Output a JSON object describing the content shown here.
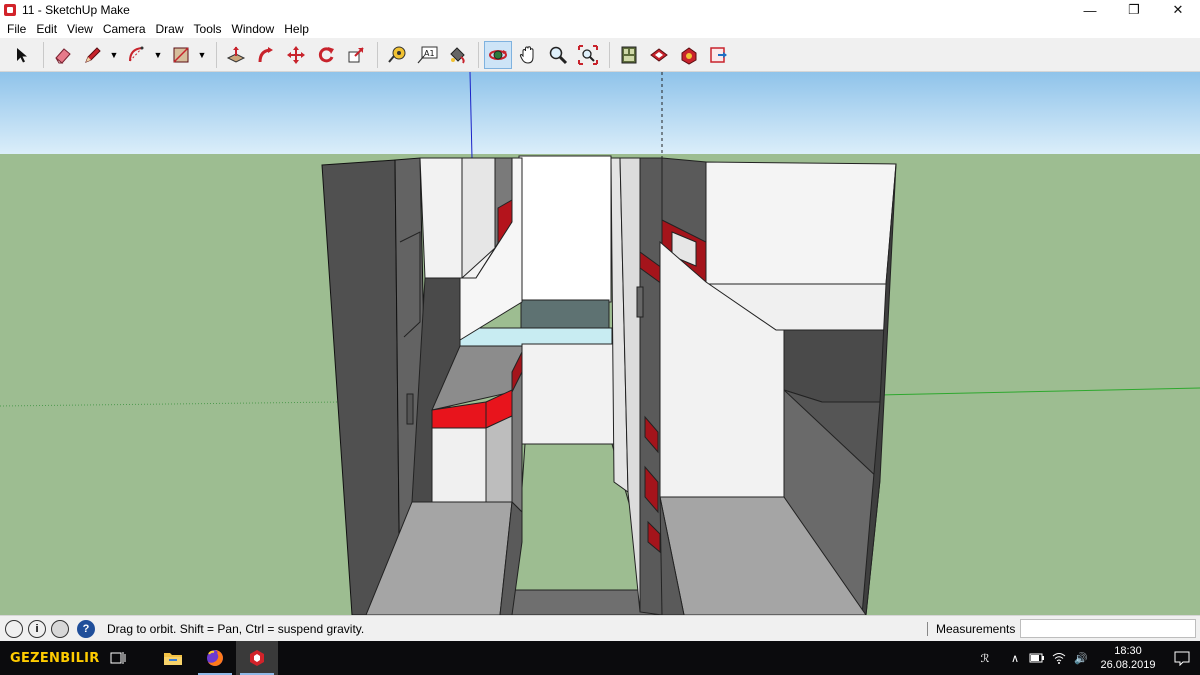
{
  "window": {
    "title": "11 - SketchUp Make",
    "minimize": "—",
    "restore": "❐",
    "close": "✕"
  },
  "menu": [
    "File",
    "Edit",
    "View",
    "Camera",
    "Draw",
    "Tools",
    "Window",
    "Help"
  ],
  "toolbar": {
    "tools": [
      {
        "name": "select-tool",
        "icon": "arrow-cursor-icon"
      },
      {
        "name": "eraser-tool",
        "icon": "eraser-icon"
      },
      {
        "name": "pencil-tool",
        "icon": "pencil-icon",
        "dropdown": true
      },
      {
        "name": "arc-tool",
        "icon": "arc-icon",
        "dropdown": true
      },
      {
        "name": "rectangle-tool",
        "icon": "rectangle-icon",
        "dropdown": true
      },
      {
        "name": "push-pull-tool",
        "icon": "push-pull-icon"
      },
      {
        "name": "follow-me-tool",
        "icon": "follow-me-icon"
      },
      {
        "name": "move-tool",
        "icon": "move-icon"
      },
      {
        "name": "rotate-tool",
        "icon": "rotate-icon"
      },
      {
        "name": "scale-tool",
        "icon": "scale-icon"
      },
      {
        "name": "tape-measure-tool",
        "icon": "tape-measure-icon"
      },
      {
        "name": "text-tool",
        "icon": "text-icon",
        "label": "A1"
      },
      {
        "name": "paint-bucket-tool",
        "icon": "paint-bucket-icon"
      },
      {
        "name": "orbit-tool",
        "icon": "orbit-icon",
        "active": true
      },
      {
        "name": "pan-tool",
        "icon": "hand-icon"
      },
      {
        "name": "zoom-tool",
        "icon": "magnifier-icon"
      },
      {
        "name": "zoom-extents-tool",
        "icon": "zoom-extents-icon"
      },
      {
        "name": "warehouse-tool",
        "icon": "warehouse-icon"
      },
      {
        "name": "share-model-tool",
        "icon": "share-model-icon"
      },
      {
        "name": "extension-warehouse-tool",
        "icon": "extension-warehouse-icon"
      },
      {
        "name": "layout-tool",
        "icon": "send-to-layout-icon"
      }
    ]
  },
  "statusbar": {
    "hint": "Drag to orbit. Shift = Pan, Ctrl = suspend gravity.",
    "measurements_label": "Measurements",
    "measurements_value": "",
    "info_glyph": "i",
    "help_glyph": "?"
  },
  "taskbar": {
    "brand": "GEZENBILIR",
    "apps": [
      "file-explorer",
      "firefox",
      "sketchup"
    ],
    "tray": {
      "people_glyph": "ℛ",
      "chevron_glyph": "∧",
      "speaker_glyph": "🔊",
      "time": "18:30",
      "date": "26.08.2019"
    }
  },
  "colors": {
    "sky_top": "#8fc3ea",
    "sky_bottom": "#dbeefa",
    "ground": "#9dbd91",
    "accent_red": "#e8141c",
    "dark_red": "#a4141b",
    "axis_blue": "#1a22c8",
    "axis_green": "#2ea82e",
    "active_tool_bg": "#cde4f7"
  }
}
